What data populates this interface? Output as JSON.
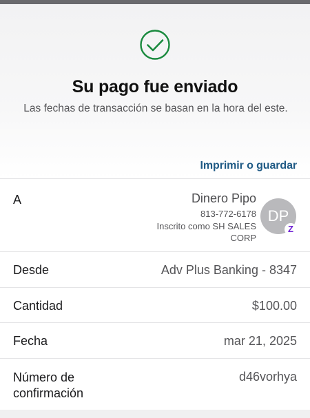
{
  "header": {
    "title": "Su pago fue enviado",
    "subtitle": "Las fechas de transacción se basan en la hora del este.",
    "print_link": "Imprimir o guardar",
    "status_icon": "check-circle-icon",
    "accent_color": "#1a8a3e"
  },
  "details": {
    "to": {
      "label": "A",
      "name": "Dinero Pipo",
      "phone": "813-772-6178",
      "registered_as": "Inscrito como SH SALES CORP",
      "avatar_initials": "DP",
      "badge_icon": "zelle-z-icon",
      "badge_text": "Z"
    },
    "from": {
      "label": "Desde",
      "value": "Adv Plus Banking - 8347"
    },
    "amount": {
      "label": "Cantidad",
      "value": "$100.00"
    },
    "date": {
      "label": "Fecha",
      "value": "mar 21, 2025"
    },
    "confirmation": {
      "label": "Número de confirmación",
      "value": "d46vorhya"
    }
  }
}
